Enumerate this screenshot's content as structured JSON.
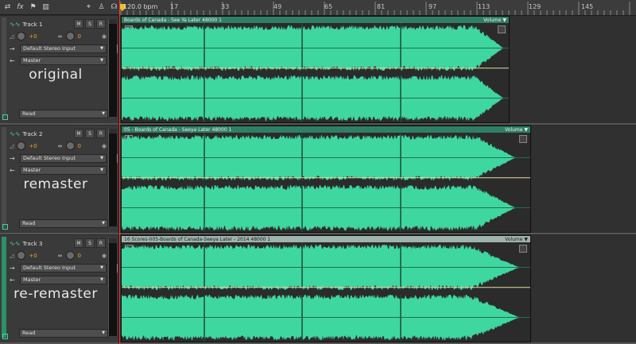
{
  "toolbar": {
    "icons": [
      "switch-icon",
      "fx-icon",
      "marker-icon",
      "meter-icon"
    ],
    "right_icons": [
      "snap-icon",
      "metronome-icon",
      "headphones-icon"
    ]
  },
  "ruler": {
    "bpm": "120.0 bpm",
    "ticks": [
      "17",
      "33",
      "49",
      "65",
      "81",
      "97",
      "113",
      "129",
      "145"
    ]
  },
  "tracks": [
    {
      "name": "Track 1",
      "mute": "M",
      "solo": "S",
      "record": "R",
      "volume": "+0",
      "pan": "0",
      "input": "Default Stereo Input",
      "output": "Master",
      "label": "original",
      "automation": "Read",
      "clip_title": "Boards of Canada - See Ya Later 48000 1",
      "clip_volume": "Volume"
    },
    {
      "name": "Track 2",
      "mute": "M",
      "solo": "S",
      "record": "R",
      "volume": "+0",
      "pan": "0",
      "input": "Default Stereo Input",
      "output": "Master",
      "label": "remaster",
      "automation": "Read",
      "clip_title": "05 - Boards of Canada - Seeya Later 48000 1",
      "clip_volume": "Volume"
    },
    {
      "name": "Track 3",
      "mute": "M",
      "solo": "S",
      "record": "R",
      "volume": "+0",
      "pan": "0",
      "input": "Default Stereo Input",
      "output": "Master",
      "label": "re-remaster",
      "automation": "Read",
      "clip_title": "16 Scores-005-Boards of Canada-Seeya Later - 2014 48000 1",
      "clip_volume": "Volume"
    }
  ],
  "colors": {
    "waveform": "#3fd7a0",
    "clip_header": "#2f7f66",
    "volume_value": "#f0a020",
    "playhead": "#ff3030"
  }
}
